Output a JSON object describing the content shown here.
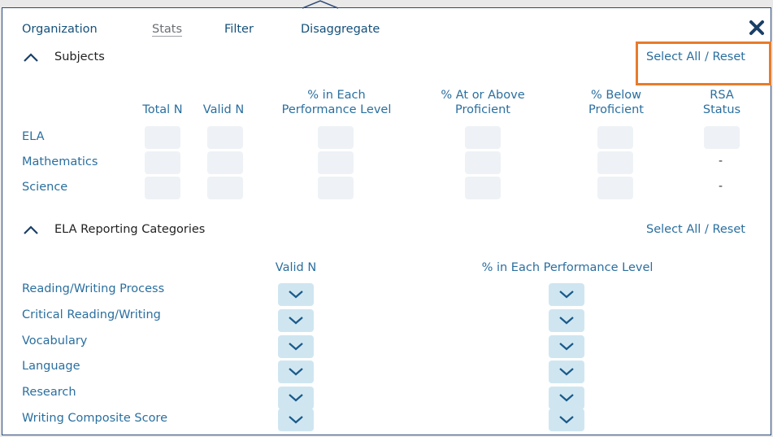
{
  "tabs": [
    {
      "label": "Organization",
      "active": false
    },
    {
      "label": "Stats",
      "active": true
    },
    {
      "label": "Filter",
      "active": false
    },
    {
      "label": "Disaggregate",
      "active": false
    }
  ],
  "subjects": {
    "title": "Subjects",
    "select_all": "Select All",
    "separator": "/",
    "reset": "Reset",
    "columns": [
      {
        "line1": "",
        "line2": "Total N"
      },
      {
        "line1": "",
        "line2": "Valid N"
      },
      {
        "line1": "% in Each",
        "line2": "Performance Level"
      },
      {
        "line1": "% At or Above",
        "line2": "Proficient"
      },
      {
        "line1": "% Below",
        "line2": "Proficient"
      },
      {
        "line1": "RSA",
        "line2": "Status"
      }
    ],
    "rows": [
      {
        "label": "ELA",
        "rsa": "box"
      },
      {
        "label": "Mathematics",
        "rsa": "-"
      },
      {
        "label": "Science",
        "rsa": "-"
      }
    ]
  },
  "ela": {
    "title": "ELA Reporting Categories",
    "select_all": "Select All",
    "separator": "/",
    "reset": "Reset",
    "columns": [
      "Valid N",
      "% in Each Performance Level"
    ],
    "rows": [
      "Reading/Writing Process",
      "Critical Reading/Writing",
      "Vocabulary",
      "Language",
      "Research",
      "Writing Composite Score"
    ]
  },
  "colors": {
    "accent": "#2a6f9f",
    "highlight": "#e87b2a",
    "check_bg": "#cfe6f1",
    "border": "#2c4a78"
  }
}
